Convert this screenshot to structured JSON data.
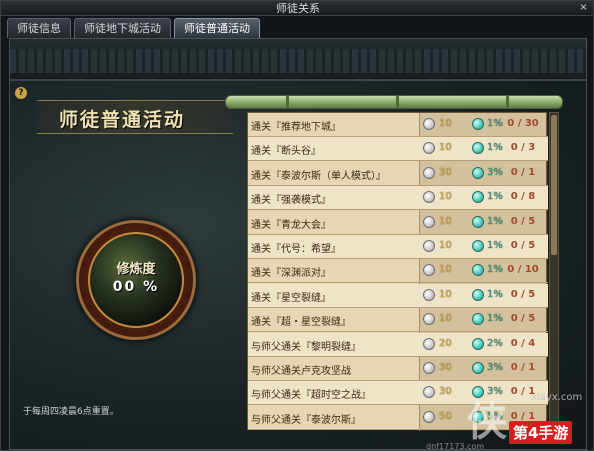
{
  "window": {
    "title": "师徒关系",
    "close_label": "×"
  },
  "tabs": [
    {
      "label": "师徒信息"
    },
    {
      "label": "师徒地下城活动"
    },
    {
      "label": "师徒普通活动"
    }
  ],
  "panel": {
    "help_label": "?",
    "title": "师徒普通活动",
    "orb_label": "修炼度",
    "orb_value": "00 %",
    "reset_note": "于每周四凌晨6点重置。"
  },
  "activities": [
    {
      "name": "通关『推荐地下城』",
      "reward": "10",
      "rate": "1%",
      "progress": "0 / 30"
    },
    {
      "name": "通关『断头谷』",
      "reward": "10",
      "rate": "1%",
      "progress": "0 / 3"
    },
    {
      "name": "通关『泰波尔斯（单人模式）』",
      "reward": "30",
      "rate": "3%",
      "progress": "0 / 1"
    },
    {
      "name": "通关『强袭模式』",
      "reward": "10",
      "rate": "1%",
      "progress": "0 / 8"
    },
    {
      "name": "通关『青龙大会』",
      "reward": "10",
      "rate": "1%",
      "progress": "0 / 5"
    },
    {
      "name": "通关『代号：希望』",
      "reward": "10",
      "rate": "1%",
      "progress": "0 / 5"
    },
    {
      "name": "通关『深渊派对』",
      "reward": "10",
      "rate": "1%",
      "progress": "0 / 10"
    },
    {
      "name": "通关『星空裂缝』",
      "reward": "10",
      "rate": "1%",
      "progress": "0 / 5"
    },
    {
      "name": "通关『超・星空裂缝』",
      "reward": "10",
      "rate": "1%",
      "progress": "0 / 5"
    },
    {
      "name": "与师父通关『黎明裂缝』",
      "reward": "20",
      "rate": "2%",
      "progress": "0 / 4"
    },
    {
      "name": "与师父通关卢克攻坚战",
      "reward": "30",
      "rate": "3%",
      "progress": "0 / 1"
    },
    {
      "name": "与师父通关『超时空之战』",
      "reward": "30",
      "rate": "3%",
      "progress": "0 / 1"
    },
    {
      "name": "与师父通关『泰波尔斯』",
      "reward": "50",
      "rate": "5%",
      "progress": "0 / 1"
    }
  ],
  "watermark": {
    "site": "xiayx.com",
    "big_char": "侠",
    "brand": "第4手游",
    "url": "dnf17173.com"
  },
  "colors": {
    "accent_gold": "#d6b04a",
    "rate_teal": "#3c9c8a",
    "progress_red": "#a14b2c",
    "parchment": "#e7d6b3"
  }
}
